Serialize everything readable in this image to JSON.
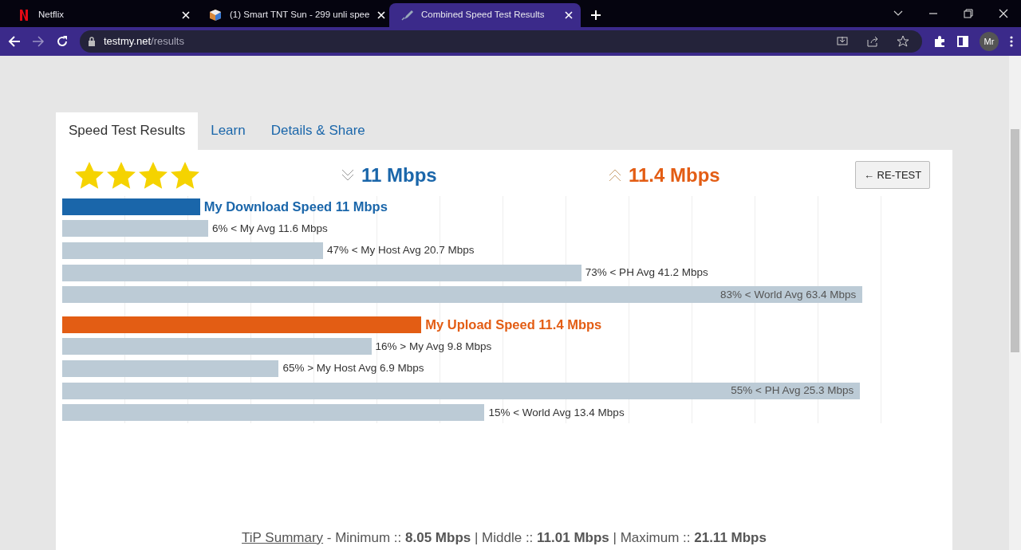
{
  "browser": {
    "tabs": [
      {
        "title": "Netflix",
        "selected": false
      },
      {
        "title": "(1) Smart TNT Sun - 299 unli spee",
        "selected": false
      },
      {
        "title": "Combined Speed Test Results",
        "selected": true
      }
    ],
    "address": {
      "host": "testmy.net",
      "path": "/results"
    },
    "profile": "Mr"
  },
  "page_tabs": [
    {
      "label": "Speed Test Results",
      "selected": true
    },
    {
      "label": "Learn",
      "selected": false
    },
    {
      "label": "Details & Share",
      "selected": false
    }
  ],
  "rating": {
    "stars": 4
  },
  "download": {
    "value": "11 Mbps"
  },
  "upload": {
    "value": "11.4 Mbps"
  },
  "retest_button": "← RE-TEST",
  "bars": [
    {
      "kind": "primary",
      "label": "My Download Speed 11 Mbps",
      "level": 0.168,
      "color": "#1a66aa"
    },
    {
      "kind": "compare",
      "label": "6% < My Avg 11.6 Mbps",
      "level": 0.178
    },
    {
      "kind": "compare",
      "label": "47% < My Host Avg 20.7 Mbps",
      "level": 0.318
    },
    {
      "kind": "compare",
      "label": "73% < PH Avg 41.2 Mbps",
      "level": 0.633
    },
    {
      "kind": "compare",
      "label": "83% < World Avg 63.4 Mbps",
      "level": 0.976
    },
    {
      "kind": "gap"
    },
    {
      "kind": "primary",
      "label": "My Upload Speed 11.4 Mbps",
      "level": 0.438,
      "color": "#e35d14"
    },
    {
      "kind": "compare",
      "label": "16% > My Avg 9.8 Mbps",
      "level": 0.377
    },
    {
      "kind": "compare",
      "label": "65% > My Host Avg 6.9 Mbps",
      "level": 0.264
    },
    {
      "kind": "compare",
      "label": "55% < PH Avg 25.3 Mbps",
      "level": 0.973
    },
    {
      "kind": "compare",
      "label": "15% < World Avg 13.4 Mbps",
      "level": 0.515
    }
  ],
  "summary": "TiP Summary",
  "summary_text": " - Minimum :: **8.05 Mbps** | Middle :: **11.01 Mbps** | Maximum :: **21.11 Mbps**"
}
